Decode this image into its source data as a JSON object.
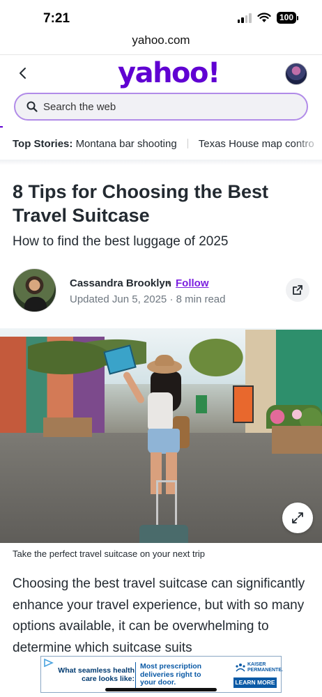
{
  "status_bar": {
    "time": "7:21",
    "battery": "100"
  },
  "browser": {
    "url": "yahoo.com"
  },
  "header": {
    "logo": "yahoo!"
  },
  "search": {
    "placeholder": "Search the web"
  },
  "top_stories": {
    "label": "Top Stories:",
    "items": [
      "Montana bar shooting",
      "Texas House map contro"
    ]
  },
  "article": {
    "title": "8 Tips for Choosing the Best Travel Suitcase",
    "subtitle": "How to find the best luggage of 2025",
    "author": "Cassandra Brooklyn",
    "separator": "•",
    "follow_label": "Follow",
    "updated": "Updated Jun 5, 2025 · 8 min read",
    "caption": "Take the perfect travel suitcase on your next trip",
    "body": "Choosing the best travel suitcase can significantly enhance your travel experience, but with so many options available, it can be overwhelming to determine which suitcase suits"
  },
  "ad": {
    "left_text": "What seamless health care looks like:",
    "middle_text": "Most prescription deliveries right to your door.",
    "brand": "KAISER PERMANENTE.",
    "cta": "LEARN MORE"
  },
  "icons": {
    "back": "chevron-left-icon",
    "search": "search-icon",
    "share": "share-icon",
    "expand": "expand-icon"
  },
  "colors": {
    "brand": "#6001d2",
    "follow": "#7b1fe0",
    "ad_blue": "#0b5aa6"
  }
}
